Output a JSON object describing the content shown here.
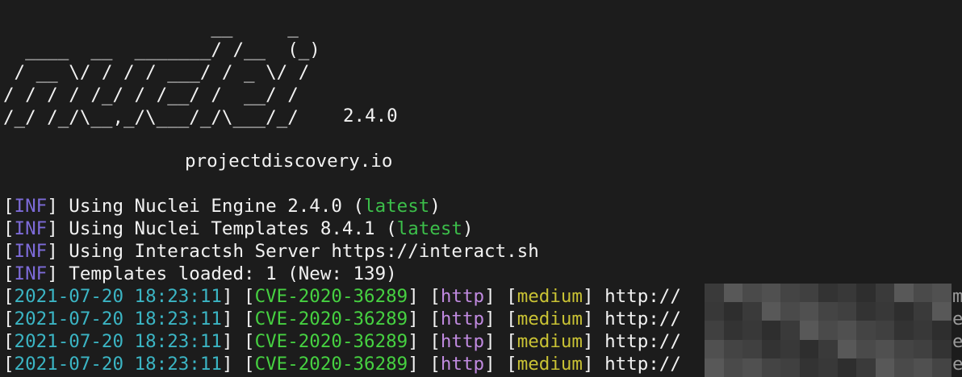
{
  "banner": {
    "ascii_art": "                   __     _\n  ____  __  _______/ /__  (_)\n / __ \\/ / / / ___/ / _ \\/ /\n/ / / / /_/ / /__/ /  __/ /\n/_/ /_/\\__,_/\\___/_/\\___/_/",
    "version": "2.4.0",
    "site": "projectdiscovery.io"
  },
  "info_lines": [
    {
      "tag": "INF",
      "text": "Using Nuclei Engine 2.4.0 (",
      "status": "latest",
      "suffix": ")"
    },
    {
      "tag": "INF",
      "text": "Using Nuclei Templates 8.4.1 (",
      "status": "latest",
      "suffix": ")"
    },
    {
      "tag": "INF",
      "text": "Using Interactsh Server https://interact.sh",
      "status": "",
      "suffix": ""
    },
    {
      "tag": "INF",
      "text": "Templates loaded: 1 (New: 139)",
      "status": "",
      "suffix": ""
    }
  ],
  "results": [
    {
      "timestamp": "2021-07-20 18:23:11",
      "template": "CVE-2020-36289",
      "protocol": "http",
      "severity": "medium",
      "url_prefix": "http://",
      "tail": "m"
    },
    {
      "timestamp": "2021-07-20 18:23:11",
      "template": "CVE-2020-36289",
      "protocol": "http",
      "severity": "medium",
      "url_prefix": "http://",
      "tail": "e"
    },
    {
      "timestamp": "2021-07-20 18:23:11",
      "template": "CVE-2020-36289",
      "protocol": "http",
      "severity": "medium",
      "url_prefix": "http://",
      "tail": "e"
    },
    {
      "timestamp": "2021-07-20 18:23:11",
      "template": "CVE-2020-36289",
      "protocol": "http",
      "severity": "medium",
      "url_prefix": "http://",
      "tail": "e"
    }
  ],
  "colors": {
    "background": "#1c1c1c",
    "text": "#f2f2f2",
    "inf_tag": "#7d6bd9",
    "latest": "#3cbf4a",
    "timestamp": "#3bb5c4",
    "template_id": "#46d141",
    "protocol": "#c08ae0",
    "severity_medium": "#c9c234"
  },
  "redaction_palette": [
    "#3a3a3a",
    "#444444",
    "#2e2e2e",
    "#505050",
    "#383838",
    "#4a4a4a",
    "#333333",
    "#585858",
    "#404040"
  ]
}
